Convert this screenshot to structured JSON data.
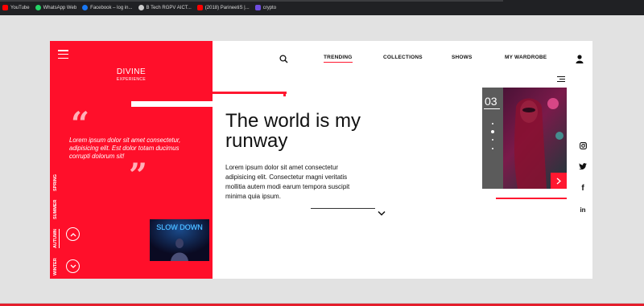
{
  "bookmarks": [
    {
      "label": "YouTube",
      "color": "#ff0000"
    },
    {
      "label": "WhatsApp Web",
      "color": "#25d366"
    },
    {
      "label": "Facebook – log in...",
      "color": "#1877f2"
    },
    {
      "label": "B Tech RGPV AICT...",
      "color": "#cccccc"
    },
    {
      "label": "(2018) ParineetiS |...",
      "color": "#ff0000"
    },
    {
      "label": "crypto",
      "color": "#6f4de0"
    }
  ],
  "brand": {
    "title": "DIVINE",
    "subtitle": "EXPERIENCE"
  },
  "quote": {
    "open_mark": "“",
    "close_mark": "”",
    "text": "Lorem ipsum dolor sit amet consectetur, adipisicing elit. Est dolor totam ducimus corrupti dolorum sit!"
  },
  "seasons": [
    "SPRING",
    "SUMMER",
    "AUTUMN",
    "WINTER"
  ],
  "active_season": "AUTUMN",
  "thumbnail": {
    "neon_text": "SLOW DOWN"
  },
  "nav": {
    "items": [
      "TRENDING",
      "COLLECTIONS",
      "SHOWS",
      "MY WARDROBE"
    ],
    "active": "TRENDING"
  },
  "hero": {
    "headline_line1": "The world is my",
    "headline_line2": "runway",
    "body": "Lorem ipsum dolor sit amet consectetur adipisicing elit. Consectetur magni veritatis mollitia autem modi earum tempora suscipit minima quia ipsum."
  },
  "feature": {
    "slide_number": "03",
    "slide_count": 4,
    "active_slide": 2
  },
  "socials": [
    "instagram-icon",
    "twitter-icon",
    "facebook-icon",
    "linkedin-icon"
  ],
  "social_text": {
    "facebook": "f",
    "linkedin": "in"
  },
  "colors": {
    "accent": "#ff0f2a",
    "background": "#e2e2e2",
    "card": "#ffffff"
  }
}
